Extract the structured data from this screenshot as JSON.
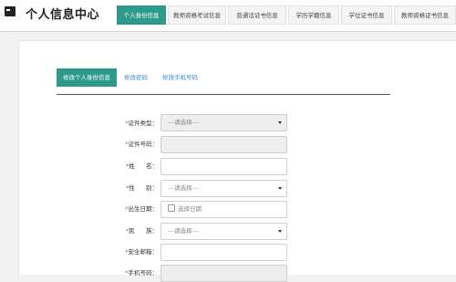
{
  "header": {
    "title": "个人信息中心",
    "tabs": [
      {
        "label": "个人身份信息",
        "active": true
      },
      {
        "label": "教师资格考试信息",
        "active": false
      },
      {
        "label": "普通话证书信息",
        "active": false
      },
      {
        "label": "学历学籍信息",
        "active": false
      },
      {
        "label": "学位证书信息",
        "active": false
      },
      {
        "label": "教师资格证书信息",
        "active": false
      }
    ]
  },
  "subtabs": [
    {
      "label": "修改个人身份信息",
      "active": true
    },
    {
      "label": "修改密码",
      "active": false
    },
    {
      "label": "修改手机号码",
      "active": false
    }
  ],
  "form": {
    "required_mark": "*",
    "fields": [
      {
        "label": "证件类型：",
        "type": "select",
        "value": "---请选择---",
        "disabled": true
      },
      {
        "label": "证件号码：",
        "type": "text",
        "value": "",
        "disabled": true
      },
      {
        "label": "姓      名：",
        "type": "text",
        "value": "",
        "disabled": false
      },
      {
        "label": "性      别：",
        "type": "select",
        "value": "---请选择---",
        "disabled": false
      },
      {
        "label": "出生日期：",
        "type": "date",
        "value": "选择日期",
        "disabled": false
      },
      {
        "label": "民      族：",
        "type": "select",
        "value": "---请选择---",
        "disabled": false
      },
      {
        "label": "安全邮箱：",
        "type": "text",
        "value": "",
        "disabled": false
      },
      {
        "label": "手机号码：",
        "type": "text",
        "value": "",
        "disabled": true
      }
    ]
  },
  "colors": {
    "accent": "#2e9b8a",
    "link": "#3a8fd8",
    "required": "#d9534f"
  }
}
